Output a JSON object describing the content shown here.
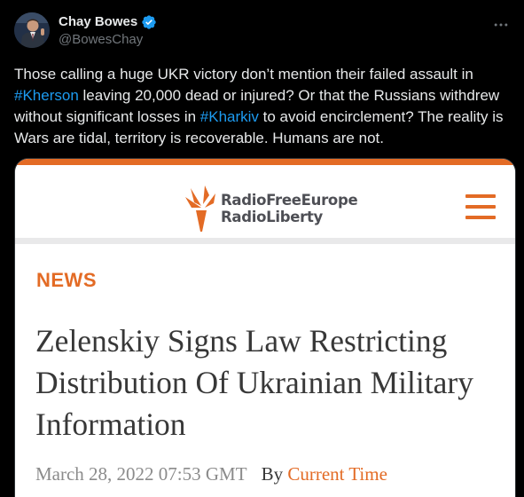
{
  "author": {
    "display_name": "Chay Bowes",
    "handle": "@BowesChay",
    "verified": true,
    "avatar_icon": "avatar-photo"
  },
  "tweet": {
    "text_parts": [
      "Those calling a huge UKR victory don’t mention their failed assault in ",
      "#Kherson",
      " leaving 20,000 dead or injured? Or that the Russians withdrew without significant losses in ",
      "#Kharkiv",
      " to avoid encirclement? The reality is Wars are tidal, territory is recoverable. Humans are not."
    ]
  },
  "card": {
    "brand_line1": "RadioFreeEurope",
    "brand_line2": "RadioLiberty",
    "section": "NEWS",
    "headline": "Zelenskiy Signs Law Restricting Distribution Of Ukrainian Military Information",
    "date": "March 28, 2022 07:53 GMT",
    "by_label": "By",
    "by_link": "Current Time",
    "menu_icon": "hamburger-icon"
  },
  "colors": {
    "background": "#000000",
    "text": "#e7e9ea",
    "secondary": "#71767b",
    "link": "#1d9bf0",
    "rfe_orange": "#e36b25",
    "card_text": "#383838"
  }
}
